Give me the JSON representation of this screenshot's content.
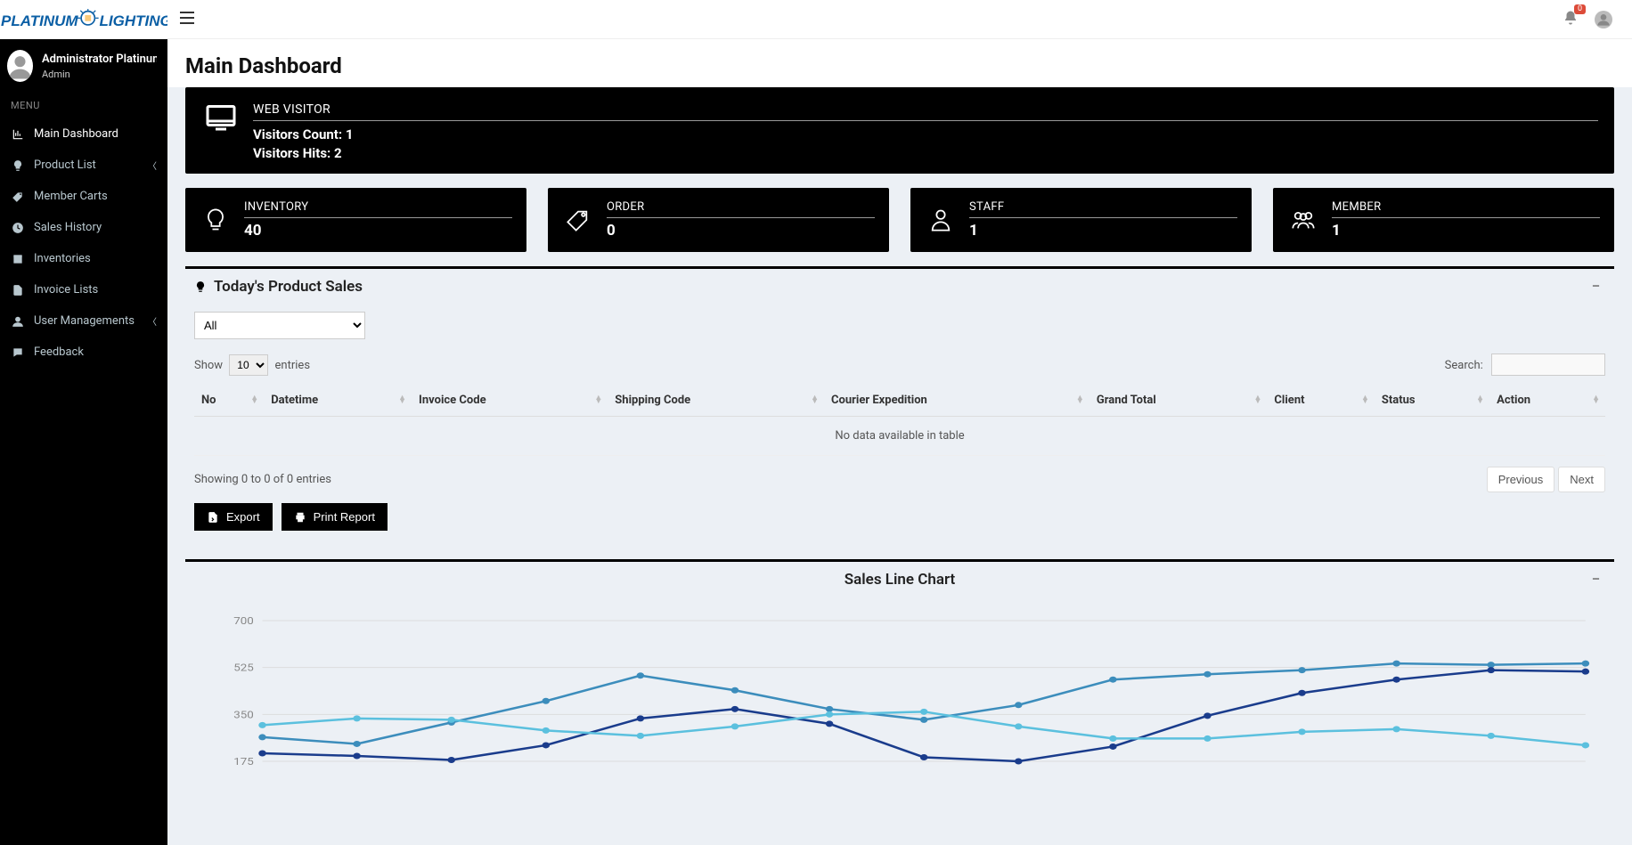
{
  "header": {
    "brand_platinum": "PLATINUM",
    "brand_lighting": "LIGHTING",
    "notification_count": "0"
  },
  "sidebar": {
    "user_name": "Administrator Platinum W...",
    "user_role": "Admin",
    "menu_label": "MENU",
    "items": [
      {
        "label": "Main Dashboard",
        "icon": "chart-icon",
        "chev": false,
        "active": true
      },
      {
        "label": "Product List",
        "icon": "bulb-icon",
        "chev": true,
        "active": false
      },
      {
        "label": "Member Carts",
        "icon": "tags-icon",
        "chev": false,
        "active": false
      },
      {
        "label": "Sales History",
        "icon": "clock-icon",
        "chev": false,
        "active": false
      },
      {
        "label": "Inventories",
        "icon": "box-icon",
        "chev": false,
        "active": false
      },
      {
        "label": "Invoice Lists",
        "icon": "file-icon",
        "chev": false,
        "active": false
      },
      {
        "label": "User Managements",
        "icon": "user-icon",
        "chev": true,
        "active": false
      },
      {
        "label": "Feedback",
        "icon": "chat-icon",
        "chev": false,
        "active": false
      }
    ]
  },
  "page": {
    "title": "Main Dashboard"
  },
  "cards": {
    "web_visitor": {
      "title": "WEB VISITOR",
      "count_label": "Visitors Count: ",
      "count_value": "1",
      "hits_label": "Visitors Hits: ",
      "hits_value": "2"
    },
    "inventory": {
      "title": "INVENTORY",
      "value": "40"
    },
    "order": {
      "title": "ORDER",
      "value": "0"
    },
    "staff": {
      "title": "STAFF",
      "value": "1"
    },
    "member": {
      "title": "MEMBER",
      "value": "1"
    }
  },
  "sales_panel": {
    "title": "Today's Product Sales",
    "filter_selected": "All",
    "show_label": "Show",
    "entries_label": "entries",
    "length_value": "10",
    "search_label": "Search:",
    "columns": [
      "No",
      "Datetime",
      "Invoice Code",
      "Shipping Code",
      "Courier Expedition",
      "Grand Total",
      "Client",
      "Status",
      "Action"
    ],
    "empty_text": "No data available in table",
    "info_text": "Showing 0 to 0 of 0 entries",
    "prev_label": "Previous",
    "next_label": "Next",
    "export_label": "Export",
    "print_label": "Print Report"
  },
  "chart_panel": {
    "title": "Sales Line Chart"
  },
  "chart_data": {
    "type": "line",
    "ylim": [
      175,
      700
    ],
    "y_ticks": [
      700,
      525,
      350,
      175
    ],
    "x": [
      0,
      1,
      2,
      3,
      4,
      5,
      6,
      7,
      8,
      9,
      10,
      11,
      12
    ],
    "series": [
      {
        "name": "series-blue",
        "color": "#3c8dbc",
        "values": [
          265,
          240,
          320,
          400,
          495,
          440,
          370,
          330,
          385,
          480,
          500,
          515,
          540,
          535,
          540
        ]
      },
      {
        "name": "series-dark",
        "color": "#1a3c8c",
        "values": [
          205,
          195,
          180,
          235,
          335,
          370,
          315,
          190,
          175,
          230,
          345,
          430,
          480,
          515,
          510
        ]
      },
      {
        "name": "series-cyan",
        "color": "#5bc0de",
        "values": [
          310,
          335,
          330,
          290,
          270,
          305,
          350,
          360,
          305,
          260,
          260,
          285,
          295,
          270,
          235
        ]
      }
    ]
  }
}
